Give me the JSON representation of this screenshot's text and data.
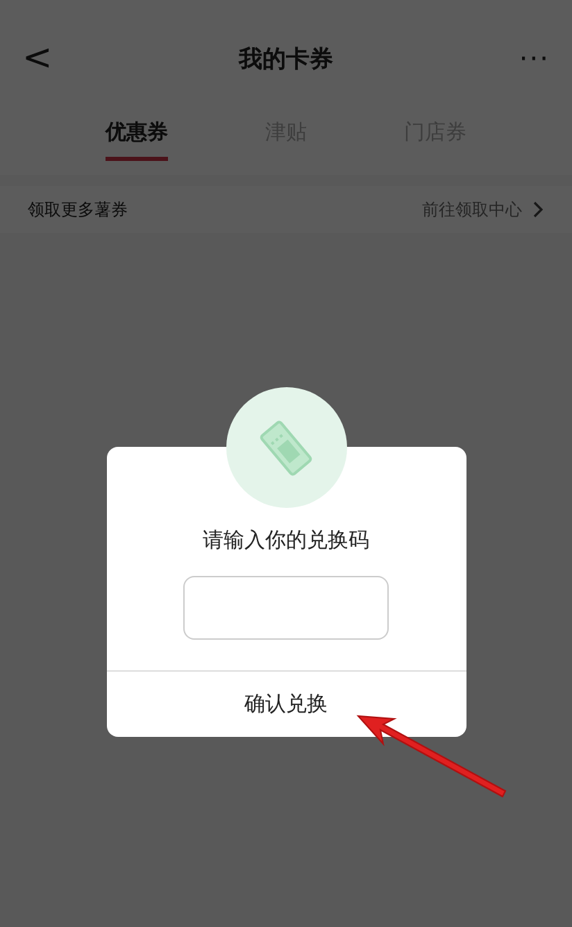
{
  "header": {
    "back": "<",
    "title": "我的卡券",
    "more": "···"
  },
  "tabs": [
    {
      "label": "优惠券",
      "selected": true
    },
    {
      "label": "津贴",
      "selected": false
    },
    {
      "label": "门店券",
      "selected": false
    }
  ],
  "promo_bar": {
    "text": "领取更多薯券",
    "link": "前往领取中心"
  },
  "dialog": {
    "prompt": "请输入你的兑换码",
    "confirm": "确认兑换"
  }
}
